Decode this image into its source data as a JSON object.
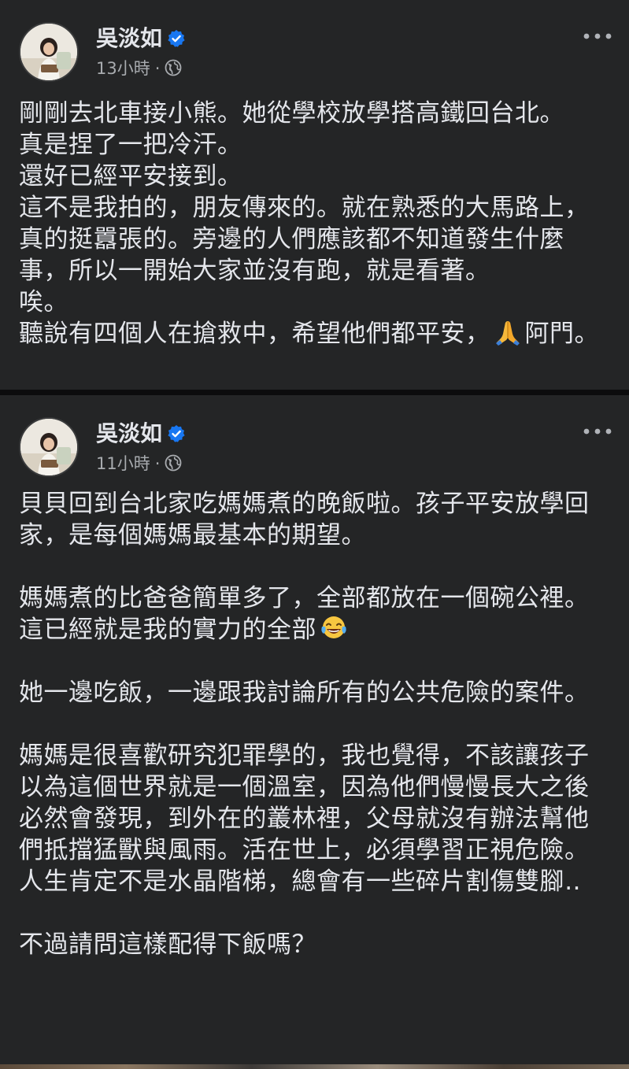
{
  "posts": [
    {
      "author": "吳淡如",
      "time": "13小時",
      "separator": "·",
      "icons": {
        "verified": "verified-badge-icon",
        "privacy": "globe-icon",
        "menu": "more-options-icon"
      },
      "text_before_emoji": "剛剛去北車接小熊。她從學校放學搭高鐵回台北。\n真是捏了一把冷汗。\n還好已經平安接到。\n這不是我拍的，朋友傳來的。就在熟悉的大馬路上，真的挺囂張的。旁邊的人們應該都不知道發生什麼事，所以一開始大家並沒有跑，就是看著。\n唉。\n聽說有四個人在搶救中，希望他們都平安，",
      "emoji": "folded-hands-icon",
      "text_after_emoji": "阿門。"
    },
    {
      "author": "吳淡如",
      "time": "11小時",
      "separator": "·",
      "icons": {
        "verified": "verified-badge-icon",
        "privacy": "globe-icon",
        "menu": "more-options-icon"
      },
      "text_before_emoji": "貝貝回到台北家吃媽媽煮的晚飯啦。孩子平安放學回家，是每個媽媽最基本的期望。\n\n媽媽煮的比爸爸簡單多了，全部都放在一個碗公裡。\n這已經就是我的實力的全部",
      "emoji": "joy-tears-icon",
      "text_after_emoji": "\n\n她一邊吃飯，一邊跟我討論所有的公共危險的案件。\n\n媽媽是很喜歡研究犯罪學的，我也覺得，不該讓孩子以為這個世界就是一個溫室，因為他們慢慢長大之後必然會發現，到外在的叢林裡，父母就沒有辦法幫他們抵擋猛獸與風雨。活在世上，必須學習正視危險。人生肯定不是水晶階梯，總會有一些碎片割傷雙腳‥\n\n不過請問這樣配得下飯嗎？"
    }
  ],
  "colors": {
    "background": "#0c0c0d",
    "card": "#242526",
    "text": "#e4e6eb",
    "meta": "#a8abaf",
    "verified": "#1877f2"
  }
}
